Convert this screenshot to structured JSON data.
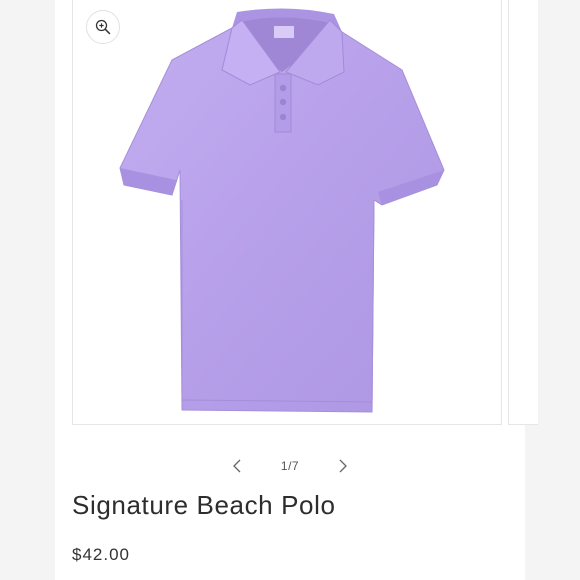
{
  "product": {
    "title": "Signature Beach Polo",
    "price": "$42.00"
  },
  "gallery": {
    "counter": "1/7",
    "image_alt": "Lavender heathered short-sleeve polo shirt",
    "shirt_color": "#b9a3ea"
  },
  "icons": {
    "zoom": "zoom-in-icon",
    "prev": "chevron-left-icon",
    "next": "chevron-right-icon"
  }
}
